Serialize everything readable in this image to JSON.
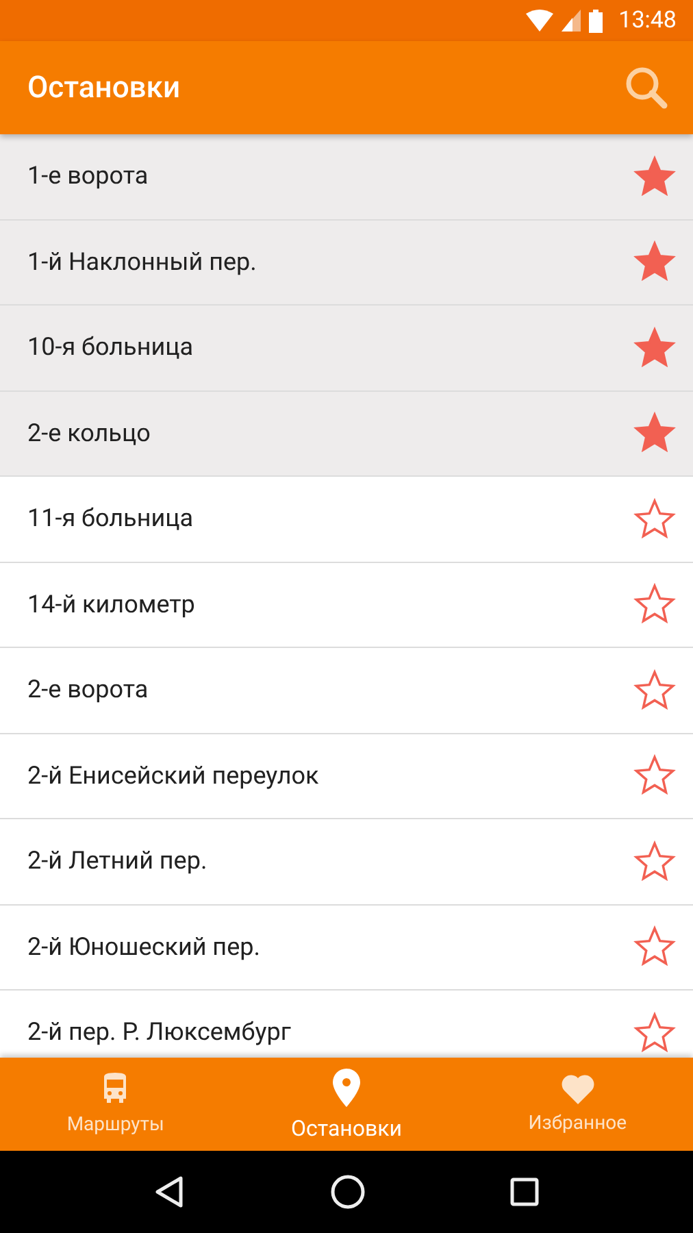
{
  "status_bar": {
    "time": "13:48"
  },
  "app_bar": {
    "title": "Остановки"
  },
  "stops": [
    {
      "name": "1-е ворота",
      "favorite": true
    },
    {
      "name": "1-й Наклонный пер.",
      "favorite": true
    },
    {
      "name": "10-я больница",
      "favorite": true
    },
    {
      "name": "2-е кольцо",
      "favorite": true
    },
    {
      "name": "11-я больница",
      "favorite": false
    },
    {
      "name": "14-й километр",
      "favorite": false
    },
    {
      "name": "2-е ворота",
      "favorite": false
    },
    {
      "name": "2-й Енисейский переулок",
      "favorite": false
    },
    {
      "name": "2-й Летний пер.",
      "favorite": false
    },
    {
      "name": "2-й Юношеский пер.",
      "favorite": false
    },
    {
      "name": "2-й пер. Р. Люксембург",
      "favorite": false
    }
  ],
  "bottom_nav": [
    {
      "label": "Маршруты",
      "kind": "bus",
      "selected": false
    },
    {
      "label": "Остановки",
      "kind": "pin",
      "selected": true
    },
    {
      "label": "Избранное",
      "kind": "heart",
      "selected": false
    }
  ]
}
